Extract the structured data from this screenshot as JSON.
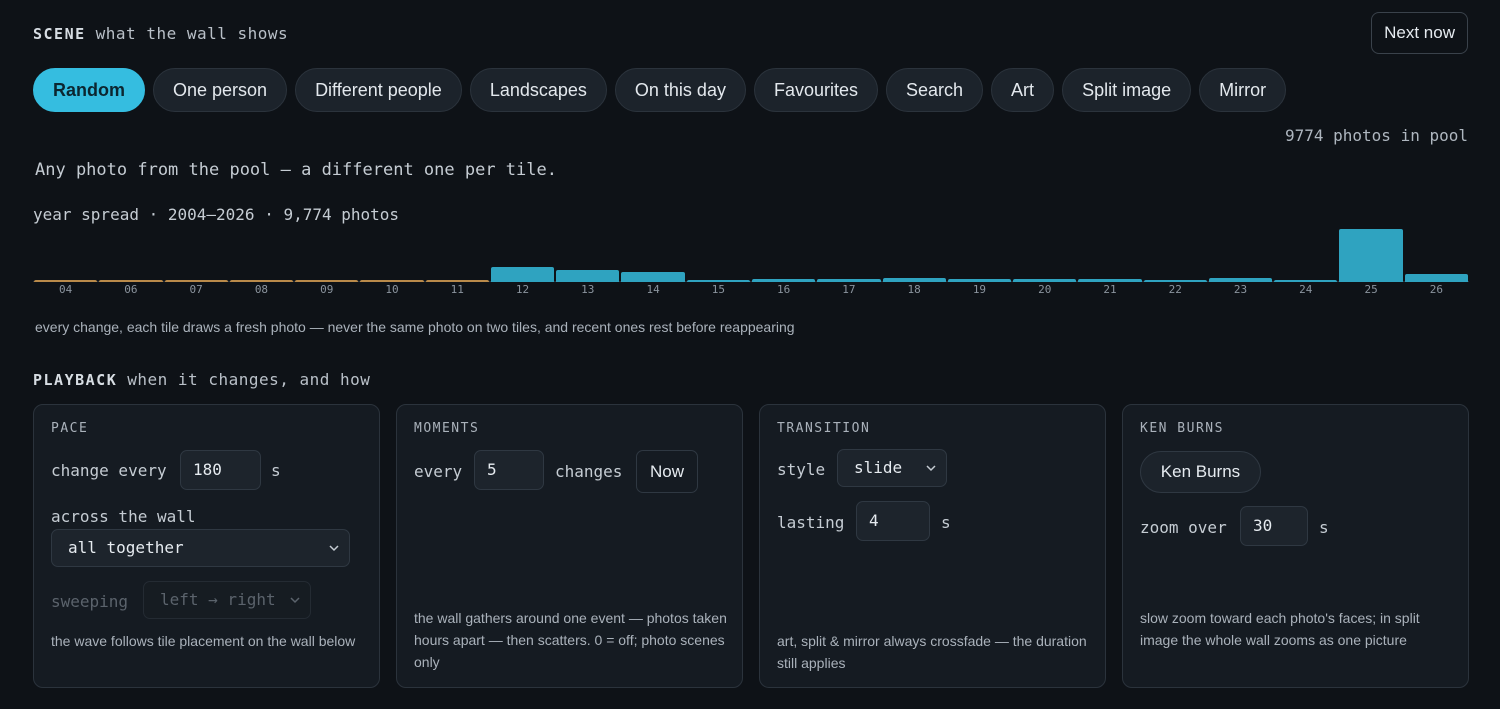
{
  "scene": {
    "label": "SCENE",
    "subtitle": "what the wall shows",
    "next_button": "Next now",
    "tabs": [
      {
        "label": "Random",
        "active": true
      },
      {
        "label": "One person",
        "active": false
      },
      {
        "label": "Different people",
        "active": false
      },
      {
        "label": "Landscapes",
        "active": false
      },
      {
        "label": "On this day",
        "active": false
      },
      {
        "label": "Favourites",
        "active": false
      },
      {
        "label": "Search",
        "active": false
      },
      {
        "label": "Art",
        "active": false
      },
      {
        "label": "Split image",
        "active": false
      },
      {
        "label": "Mirror",
        "active": false
      }
    ],
    "pool_count": "9774 photos in pool",
    "description": "Any photo from the pool — a different one per tile.",
    "year_spread": "year spread · 2004–2026 · 9,774 photos",
    "histogram_note": "every change, each tile draws a fresh photo — never the same photo on two tiles, and recent ones rest before reappearing"
  },
  "colors": {
    "accent": "#35bde0",
    "bar_active": "#2fa3c0",
    "bar_sparse": "#b98a4a",
    "background": "#0e1217"
  },
  "chart_data": {
    "type": "bar",
    "categories": [
      "04",
      "06",
      "07",
      "08",
      "09",
      "10",
      "11",
      "12",
      "13",
      "14",
      "15",
      "16",
      "17",
      "18",
      "19",
      "20",
      "21",
      "22",
      "23",
      "24",
      "25",
      "26"
    ],
    "values": [
      2,
      2,
      2,
      2,
      2,
      2,
      2,
      15,
      12,
      10,
      2,
      3,
      3,
      4,
      3,
      3,
      3,
      2,
      4,
      2,
      53,
      8
    ],
    "highlight": [
      false,
      false,
      false,
      false,
      false,
      false,
      false,
      true,
      true,
      true,
      true,
      true,
      true,
      true,
      true,
      true,
      true,
      true,
      true,
      true,
      true,
      true
    ]
  },
  "playback": {
    "label": "PLAYBACK",
    "subtitle": "when it changes, and how",
    "pace": {
      "title": "PACE",
      "change_every_label": "change every",
      "change_every_value": "180",
      "unit": "s",
      "across_label": "across the wall",
      "across_value": "all together",
      "sweeping_label": "sweeping",
      "sweeping_value": "left → right",
      "note": "the wave follows tile placement on the wall below"
    },
    "moments": {
      "title": "MOMENTS",
      "every_label": "every",
      "every_value": "5",
      "changes_label": "changes",
      "now_button": "Now",
      "note": "the wall gathers around one event — photos taken hours apart — then scatters. 0 = off; photo scenes only"
    },
    "transition": {
      "title": "TRANSITION",
      "style_label": "style",
      "style_value": "slide",
      "lasting_label": "lasting",
      "lasting_value": "4",
      "unit": "s",
      "note": "art, split & mirror always crossfade — the duration still applies"
    },
    "ken_burns": {
      "title": "KEN BURNS",
      "toggle_button": "Ken Burns",
      "zoom_label": "zoom over",
      "zoom_value": "30",
      "unit": "s",
      "note": "slow zoom toward each photo's faces; in split image the whole wall zooms as one picture"
    }
  }
}
